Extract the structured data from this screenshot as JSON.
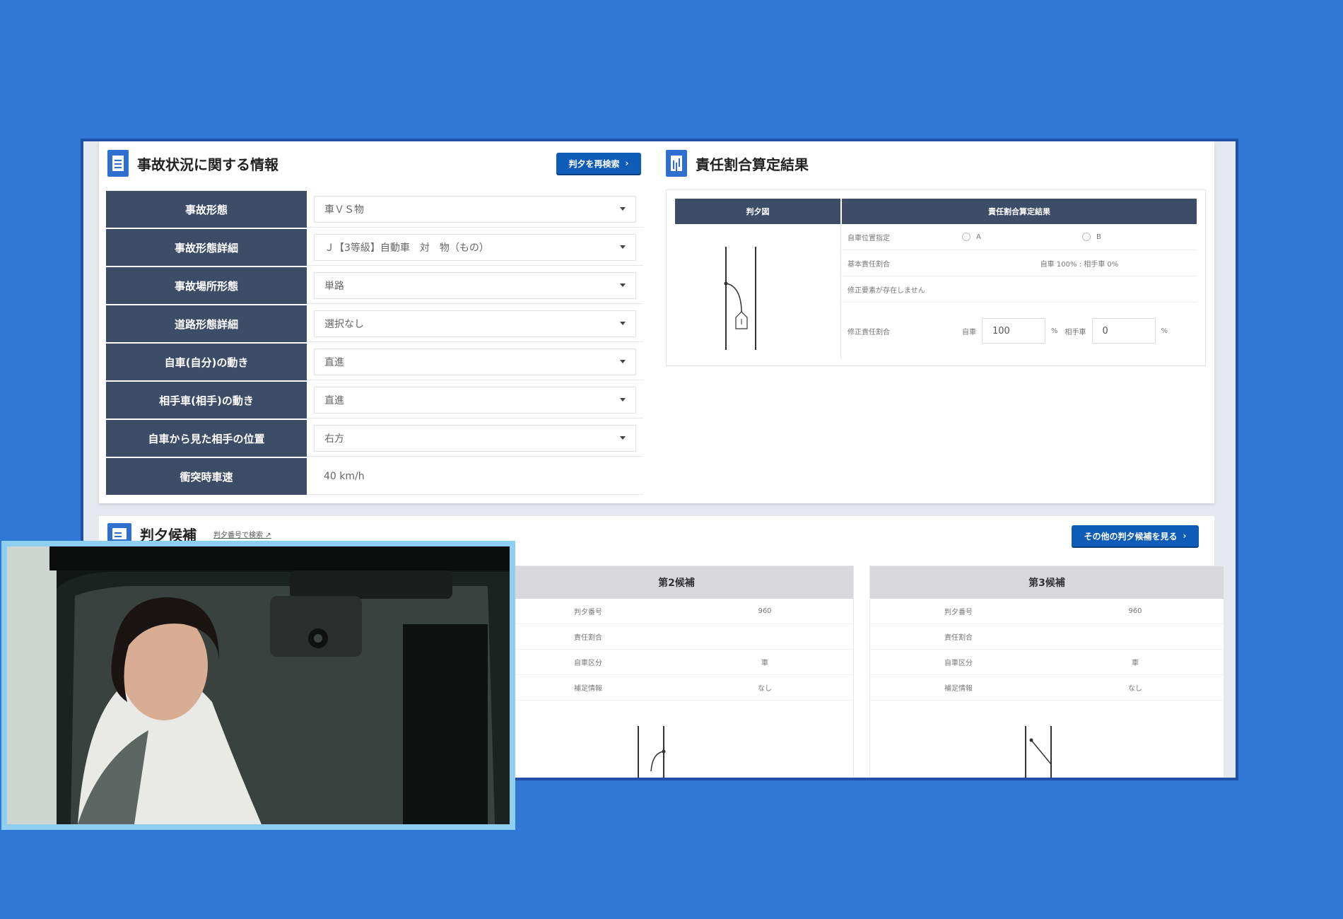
{
  "accident_info": {
    "title": "事故状況に関する情報",
    "research_button": "判夕を再検索",
    "rows": [
      {
        "label": "事故形態",
        "value": "車ＶＳ物",
        "type": "select"
      },
      {
        "label": "事故形態詳細",
        "value": "Ｊ【3等級】自動車　対　物（もの）",
        "type": "select"
      },
      {
        "label": "事故場所形態",
        "value": "単路",
        "type": "select"
      },
      {
        "label": "道路形態詳細",
        "value": "選択なし",
        "type": "select"
      },
      {
        "label": "自車(自分)の動き",
        "value": "直進",
        "type": "select"
      },
      {
        "label": "相手車(相手)の動き",
        "value": "直進",
        "type": "select"
      },
      {
        "label": "自車から見た相手の位置",
        "value": "右方",
        "type": "select"
      },
      {
        "label": "衝突時車速",
        "value": "40 km/h",
        "type": "text"
      }
    ]
  },
  "liability_result": {
    "title": "責任割合算定結果",
    "col_diagram": "判夕図",
    "col_result": "責任割合算定結果",
    "own_position_label": "自車位置指定",
    "option_a": "A",
    "option_b": "B",
    "base_ratio_label": "基本責任割合",
    "base_ratio_value": "自車 100% : 相手車 0%",
    "no_correction": "修正要素が存在しません",
    "corrected_label": "修正責任割合",
    "own_prefix": "自車",
    "own_value": "100",
    "other_prefix": "相手車",
    "other_value": "0",
    "percent": "%"
  },
  "candidates": {
    "title": "判夕候補",
    "search_link": "判夕番号で検索",
    "other_button": "その他の判夕候補を見る",
    "cards": [
      {
        "heading": "第2候補",
        "rows": [
          {
            "key": "判夕番号",
            "value": "960"
          },
          {
            "key": "責任割合",
            "value": ""
          },
          {
            "key": "自車区分",
            "value": "車"
          },
          {
            "key": "補足情報",
            "value": "なし"
          }
        ]
      },
      {
        "heading": "第3候補",
        "rows": [
          {
            "key": "判夕番号",
            "value": "960"
          },
          {
            "key": "責任割合",
            "value": ""
          },
          {
            "key": "自車区分",
            "value": "車"
          },
          {
            "key": "補足情報",
            "value": "なし"
          }
        ]
      }
    ]
  },
  "colors": {
    "background": "#3177d6",
    "header_navy": "#3d4d68",
    "button_blue": "#0e5cb8",
    "video_border": "#8fd0f2"
  }
}
